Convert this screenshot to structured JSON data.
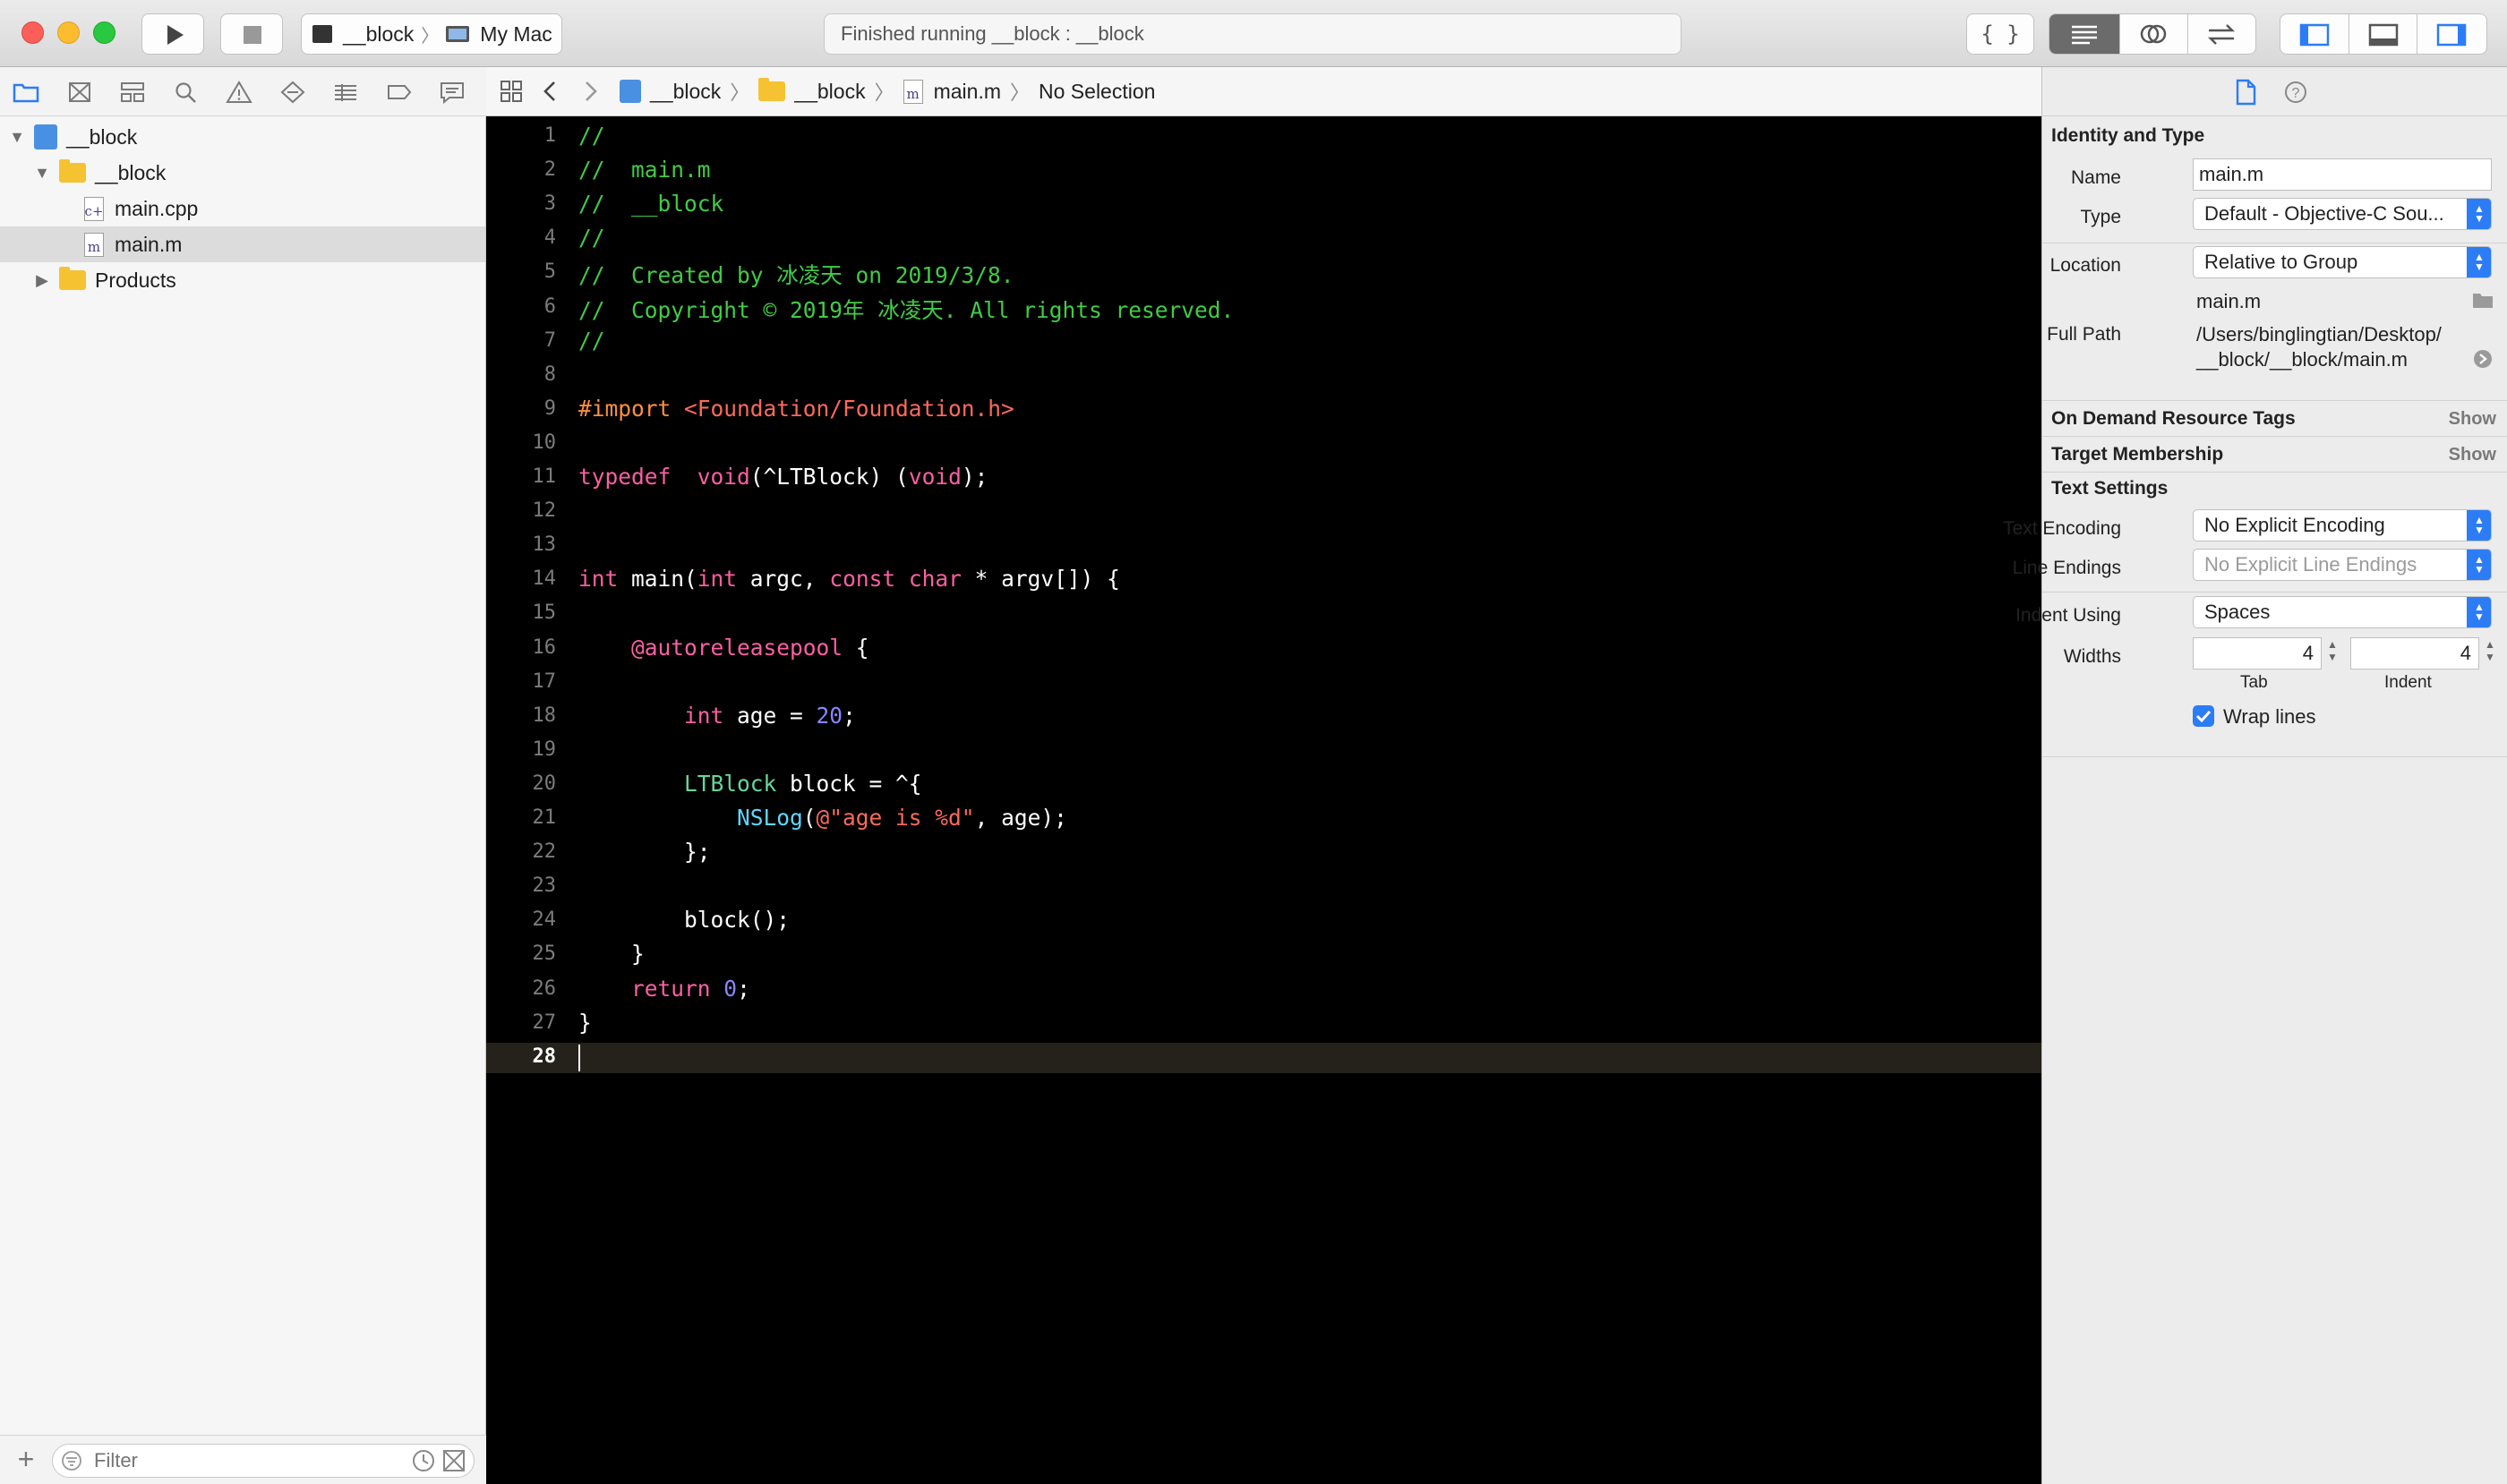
{
  "toolbar": {
    "scheme_target": "__block",
    "scheme_destination": "My Mac",
    "status_text": "Finished running __block : __block"
  },
  "navigator": {
    "tree": [
      {
        "label": "__block",
        "indent": 0,
        "kind": "project",
        "expanded": true
      },
      {
        "label": "__block",
        "indent": 1,
        "kind": "folder",
        "expanded": true
      },
      {
        "label": "main.cpp",
        "indent": 2,
        "kind": "file",
        "badge": "c+",
        "expanded": null
      },
      {
        "label": "main.m",
        "indent": 2,
        "kind": "file",
        "badge": "m",
        "expanded": null,
        "selected": true
      },
      {
        "label": "Products",
        "indent": 1,
        "kind": "folder",
        "expanded": false
      }
    ],
    "filter_placeholder": "Filter"
  },
  "jumpbar": {
    "crumbs": [
      "__block",
      "__block",
      "main.m",
      "No Selection"
    ]
  },
  "editor": {
    "current_line": 28,
    "lines": [
      [
        [
          "cm",
          "//"
        ]
      ],
      [
        [
          "cm",
          "//  main.m"
        ]
      ],
      [
        [
          "cm",
          "//  __block"
        ]
      ],
      [
        [
          "cm",
          "//"
        ]
      ],
      [
        [
          "cm",
          "//  Created by 冰凌天 on 2019/3/8."
        ]
      ],
      [
        [
          "cm",
          "//  Copyright © 2019年 冰凌天. All rights reserved."
        ]
      ],
      [
        [
          "cm",
          "//"
        ]
      ],
      [],
      [
        [
          "pp",
          "#import "
        ],
        [
          "str",
          "<Foundation/Foundation.h>"
        ]
      ],
      [],
      [
        [
          "kw",
          "typedef"
        ],
        [
          "",
          "  "
        ],
        [
          "kw",
          "void"
        ],
        [
          "",
          "(^LTBlock) ("
        ],
        [
          "kw",
          "void"
        ],
        [
          "",
          ");"
        ]
      ],
      [],
      [],
      [
        [
          "kw",
          "int"
        ],
        [
          "",
          " main("
        ],
        [
          "kw",
          "int"
        ],
        [
          "",
          " argc, "
        ],
        [
          "kw",
          "const"
        ],
        [
          "",
          " "
        ],
        [
          "kw",
          "char"
        ],
        [
          "",
          " * argv[]) {"
        ]
      ],
      [],
      [
        [
          "",
          "    "
        ],
        [
          "kw",
          "@autoreleasepool"
        ],
        [
          "",
          " {"
        ]
      ],
      [],
      [
        [
          "",
          "        "
        ],
        [
          "kw",
          "int"
        ],
        [
          "",
          " age = "
        ],
        [
          "num",
          "20"
        ],
        [
          "",
          ";"
        ]
      ],
      [],
      [
        [
          "",
          "        "
        ],
        [
          "uty",
          "LTBlock"
        ],
        [
          "",
          " block = ^{"
        ]
      ],
      [
        [
          "",
          "            "
        ],
        [
          "ty",
          "NSLog"
        ],
        [
          "",
          "("
        ],
        [
          "str",
          "@\"age is %d\""
        ],
        [
          "",
          ", age);"
        ]
      ],
      [
        [
          "",
          "        };"
        ]
      ],
      [],
      [
        [
          "",
          "        block();"
        ]
      ],
      [
        [
          "",
          "    }"
        ]
      ],
      [
        [
          "",
          "    "
        ],
        [
          "kw",
          "return"
        ],
        [
          "",
          " "
        ],
        [
          "num",
          "0"
        ],
        [
          "",
          ";"
        ]
      ],
      [
        [
          "",
          "}"
        ]
      ],
      []
    ]
  },
  "inspector": {
    "identity_title": "Identity and Type",
    "name_label": "Name",
    "name_value": "main.m",
    "type_label": "Type",
    "type_value": "Default - Objective-C Sou...",
    "location_label": "Location",
    "location_value": "Relative to Group",
    "location_file": "main.m",
    "fullpath_label": "Full Path",
    "fullpath_line1": "/Users/binglingtian/Desktop/",
    "fullpath_line2": "__block/__block/main.m",
    "odr_title": "On Demand Resource Tags",
    "odr_show": "Show",
    "target_title": "Target Membership",
    "target_show": "Show",
    "text_settings_title": "Text Settings",
    "encoding_label": "Text Encoding",
    "encoding_value": "No Explicit Encoding",
    "endings_label": "Line Endings",
    "endings_value": "No Explicit Line Endings",
    "indent_label": "Indent Using",
    "indent_value": "Spaces",
    "widths_label": "Widths",
    "tab_width": "4",
    "indent_width": "4",
    "tab_caption": "Tab",
    "indent_caption": "Indent",
    "wrap_label": "Wrap lines",
    "wrap_checked": true
  },
  "colors": {
    "accent": "#2c7cf6",
    "comment": "#41cc45",
    "keyword": "#fc5fa3",
    "string": "#fc6a5d",
    "number": "#8b84ff",
    "preprocessor": "#fd8f3f"
  }
}
